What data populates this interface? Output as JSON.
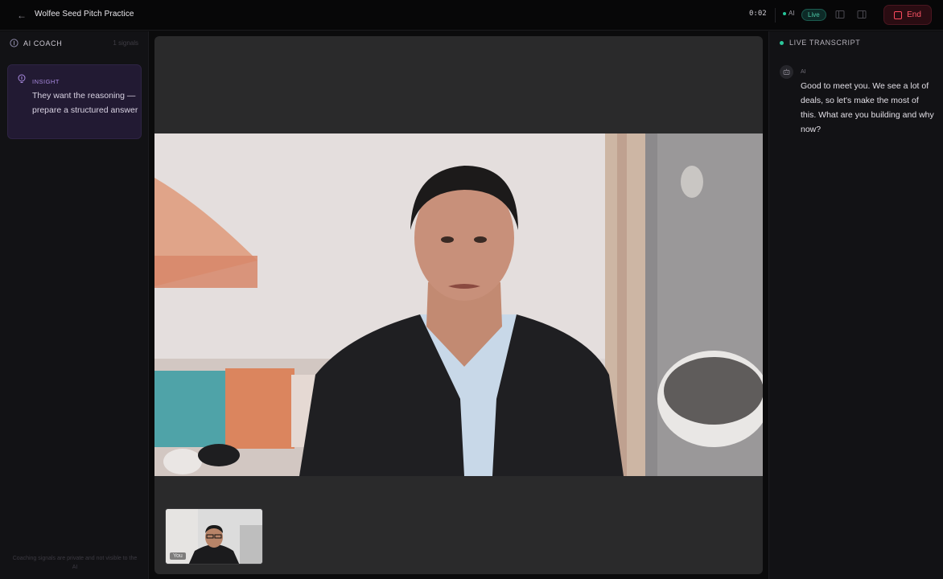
{
  "header": {
    "title": "Wolfee Seed Pitch Practice",
    "timer": "0:02",
    "ai_label": "AI",
    "live_label": "Live",
    "end_label": "End"
  },
  "coach": {
    "heading": "AI COACH",
    "signals": "1 signals",
    "insight": {
      "label": "INSIGHT",
      "text": "They want the reasoning — prepare a structured answer"
    },
    "footer": "Coaching signals are private and not visible to the AI"
  },
  "video": {
    "self_label": "You"
  },
  "transcript": {
    "heading": "LIVE TRANSCRIPT",
    "messages": [
      {
        "speaker": "AI",
        "text": "Good to meet you. We see a lot of deals, so let's make the most of this. What are you building and why now?"
      }
    ]
  },
  "colors": {
    "accent_live": "#4cc7a6",
    "end_red": "#ff5567",
    "insight_purple": "#a98ae0"
  },
  "icons": {
    "back": "arrow-left-icon",
    "coach": "info-circle-icon",
    "insight": "lightbulb-icon",
    "layout_1": "panel-left-icon",
    "layout_2": "panel-right-icon",
    "end": "stop-square-icon",
    "ai_avatar": "bot-icon"
  }
}
